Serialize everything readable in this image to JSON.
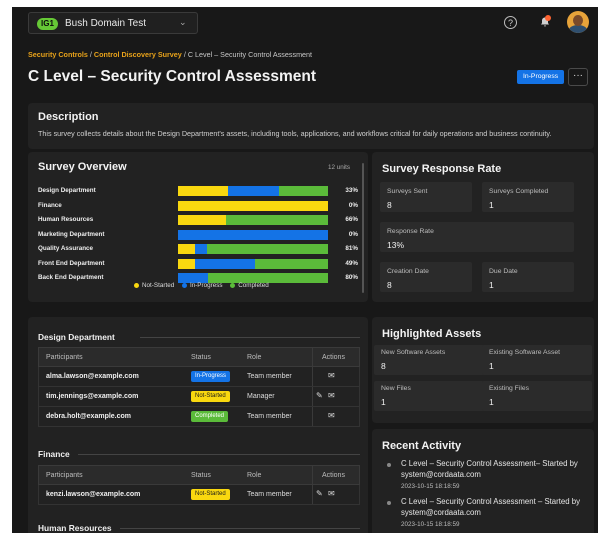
{
  "topbar": {
    "org_badge": "IG1",
    "org_name": "Bush Domain Test",
    "icons": [
      "chevron-down-icon",
      "help-icon",
      "bell-icon",
      "avatar"
    ]
  },
  "breadcrumb": {
    "items": [
      "Security Controls",
      "Control Discovery Survey",
      "C Level – Security Control Assessment"
    ],
    "separator": "/"
  },
  "page": {
    "title": "C Level – Security Control Assessment",
    "status": "In-Progress",
    "more_label": "···"
  },
  "description": {
    "heading": "Description",
    "text": "This survey collects details about the Design Department's assets, including tools, applications, and workflows critical for daily operations and business continuity."
  },
  "overview": {
    "heading": "Survey Overview",
    "units": "12 units",
    "legend": [
      "Not-Started",
      "In-Progress",
      "Completed"
    ],
    "colors": {
      "not_started": "#f9d80f",
      "in_progress": "#1473e6",
      "completed": "#5bbb3a"
    }
  },
  "chart_data": {
    "type": "bar",
    "orientation": "horizontal",
    "stacked": true,
    "categories": [
      "Design Department",
      "Finance",
      "Human Resources",
      "Marketing Department",
      "Quality Assurance",
      "Front End Department",
      "Back End Department"
    ],
    "series": [
      {
        "name": "Not-Started",
        "values": [
          33,
          100,
          32,
          0,
          11,
          11,
          0
        ]
      },
      {
        "name": "In-Progress",
        "values": [
          34,
          0,
          0,
          100,
          8,
          40,
          20
        ]
      },
      {
        "name": "Completed",
        "values": [
          33,
          0,
          68,
          0,
          81,
          49,
          80
        ]
      }
    ],
    "percent_labels": [
      "33%",
      "0%",
      "66%",
      "0%",
      "81%",
      "49%",
      "80%"
    ],
    "xlim": [
      0,
      100
    ]
  },
  "response_rate": {
    "heading": "Survey Response Rate",
    "tiles": [
      {
        "label": "Surveys Sent",
        "value": "8"
      },
      {
        "label": "Surveys Completed",
        "value": "1"
      },
      {
        "label": "Response Rate",
        "value": "13%"
      },
      {
        "label": "Creation Date",
        "value": "8"
      },
      {
        "label": "Due Date",
        "value": "1"
      }
    ]
  },
  "participants": {
    "columns": [
      "Participants",
      "Status",
      "Role",
      "Actions"
    ],
    "sections": [
      {
        "name": "Design Department",
        "rows": [
          {
            "email": "alma.lawson@example.com",
            "status": "In-Progress",
            "role": "Team member",
            "edit": false
          },
          {
            "email": "tim.jennings@example.com",
            "status": "Not-Started",
            "role": "Manager",
            "edit": true
          },
          {
            "email": "debra.holt@example.com",
            "status": "Completed",
            "role": "Team member",
            "edit": false
          }
        ]
      },
      {
        "name": "Finance",
        "rows": [
          {
            "email": "kenzi.lawson@example.com",
            "status": "Not-Started",
            "role": "Team member",
            "edit": true
          }
        ]
      },
      {
        "name": "Human Resources",
        "rows": []
      }
    ]
  },
  "highlighted_assets": {
    "heading": "Highlighted Assets",
    "tiles": [
      {
        "label": "New Software Assets",
        "value": "8"
      },
      {
        "label": "Existing Software Asset",
        "value": "1"
      },
      {
        "label": "New Files",
        "value": "1"
      },
      {
        "label": "Existing Files",
        "value": "1"
      }
    ]
  },
  "recent_activity": {
    "heading": "Recent Activity",
    "items": [
      {
        "text": "C Level – Security Control Assessment– Started by system@cordaata.com",
        "time": "2023-10-15 18:18:59"
      },
      {
        "text": "C Level – Security Control Assessment – Started by system@cordaata.com",
        "time": "2023-10-15 18:18:59"
      }
    ]
  }
}
